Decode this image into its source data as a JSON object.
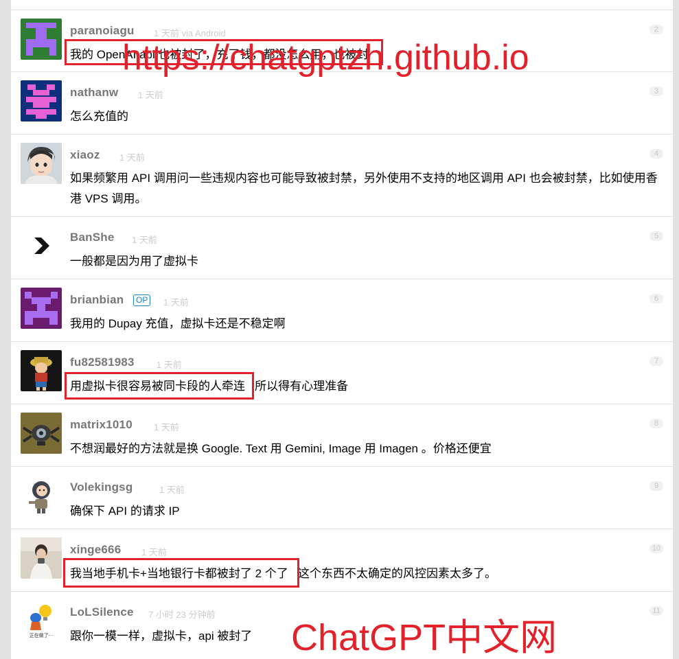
{
  "replies": [
    {
      "user": "paranoiagu",
      "time": "1 天前 via Android",
      "num": "2",
      "content": "我的 OpenAI api 也被封了，充了钱，都没怎么用，也被封"
    },
    {
      "user": "nathanw",
      "time": "1 天前",
      "num": "3",
      "content": "怎么充值的"
    },
    {
      "user": "xiaoz",
      "time": "1 天前",
      "num": "4",
      "content": "如果频繁用 API 调用问一些违规内容也可能导致被封禁，另外使用不支持的地区调用 API 也会被封禁，比如使用香港 VPS 调用。"
    },
    {
      "user": "BanShe",
      "time": "1 天前",
      "num": "5",
      "content": "一般都是因为用了虚拟卡"
    },
    {
      "user": "brianbian",
      "op": "OP",
      "time": "1 天前",
      "num": "6",
      "content": "我用的 Dupay 充值，虚拟卡还是不稳定啊"
    },
    {
      "user": "fu82581983",
      "time": "1 天前",
      "num": "7",
      "content": "用虚拟卡很容易被同卡段的人牵连   所以得有心理准备"
    },
    {
      "user": "matrix1010",
      "time": "1 天前",
      "num": "8",
      "content": "不想润最好的方法就是换 Google. Text 用 Gemini, Image 用 Imagen 。价格还便宜"
    },
    {
      "user": "Volekingsg",
      "time": "1 天前",
      "num": "9",
      "content": "确保下 API 的请求 IP"
    },
    {
      "user": "xinge666",
      "time": "1 天前",
      "num": "10",
      "content": "我当地手机卡+当地银行卡都被封了 2 个了   这个东西不太确定的风控因素太多了。"
    },
    {
      "user": "LoLSilence",
      "time": "7 小时 23 分钟前",
      "num": "11",
      "content": "跟你一模一样，虚拟卡，api 被封了"
    }
  ],
  "watermarks": {
    "url": "https://chatgptzh.github.io",
    "site": "ChatGPT中文网"
  },
  "avatar_text": {
    "lolsilence": "正在做了···"
  },
  "colors": {
    "highlight": "#e3212b",
    "op_badge": "#1484cd",
    "username": "#777777",
    "meta": "#cccccc"
  }
}
